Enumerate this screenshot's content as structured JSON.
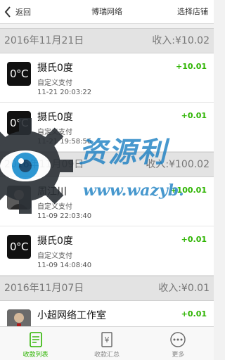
{
  "topbar": {
    "back_label": "返回",
    "title": "博瑞网络",
    "right_label": "选择店铺"
  },
  "colors": {
    "accent": "#2db400",
    "watermark": "#1a7fc2"
  },
  "sections": [
    {
      "date": "2016年11月21日",
      "income": "收入:¥10.02",
      "records": [
        {
          "avatar": "0°C",
          "name": "摄氏0度",
          "type": "自定义支付",
          "time": "11-21 20:03:22",
          "amount": "+10.01"
        },
        {
          "avatar": "0°C",
          "name": "摄氏0度",
          "type": "自定义支付",
          "time": "11-21 19:58:56",
          "amount": "+0.01"
        }
      ]
    },
    {
      "date": "2016年11月09日",
      "income": "收入:¥100.02",
      "records": [
        {
          "avatar": "",
          "name": "周江川",
          "type": "自定义支付",
          "time": "11-09 22:03:40",
          "amount": "+100.01"
        },
        {
          "avatar": "0°C",
          "name": "摄氏0度",
          "type": "自定义支付",
          "time": "11-09 14:08:40",
          "amount": "+0.01"
        }
      ]
    },
    {
      "date": "2016年11月07日",
      "income": "收入:¥0.01",
      "records": [
        {
          "avatar": "",
          "name": "小超网络工作室",
          "type": "自定义支付",
          "time": "",
          "amount": "+0.01"
        }
      ]
    }
  ],
  "tabs": [
    {
      "label": "收款列表",
      "icon": "receipt-list-icon",
      "active": true
    },
    {
      "label": "收款汇总",
      "icon": "yuan-summary-icon",
      "active": false
    },
    {
      "label": "更多",
      "icon": "more-dots-icon",
      "active": false
    }
  ],
  "watermark": {
    "text": "资源利",
    "url": "www.wazyb."
  }
}
